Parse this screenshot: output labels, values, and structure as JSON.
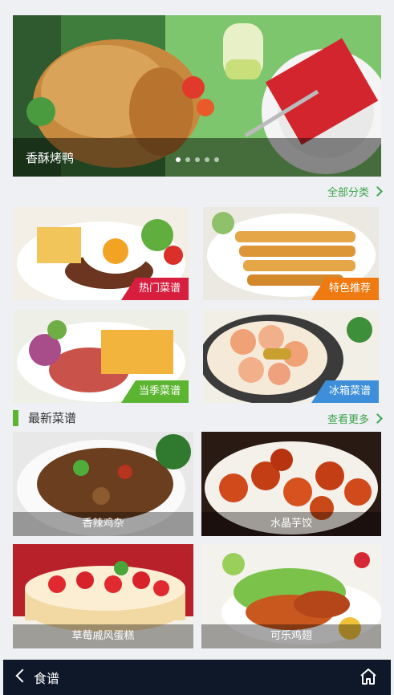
{
  "hero": {
    "title": "香酥烤鸭",
    "dots": 5,
    "active_dot": 0
  },
  "all_categories_label": "全部分类",
  "categories": [
    {
      "label": "热门菜谱",
      "color": "#d81e3f"
    },
    {
      "label": "特色推荐",
      "color": "#f07a12"
    },
    {
      "label": "当季菜谱",
      "color": "#5cb531"
    },
    {
      "label": "冰箱菜谱",
      "color": "#3d8fd9"
    }
  ],
  "latest": {
    "title": "最新菜谱",
    "see_more": "查看更多"
  },
  "recipes": [
    {
      "name": "香辣鸡杂"
    },
    {
      "name": "水晶芋饺"
    },
    {
      "name": "草莓戚风蛋糕"
    },
    {
      "name": "可乐鸡翅"
    }
  ],
  "bottom_bar": {
    "title": "食谱"
  },
  "colors": {
    "accent": "#3ca44b",
    "bottom_bar": "#0e1828"
  }
}
